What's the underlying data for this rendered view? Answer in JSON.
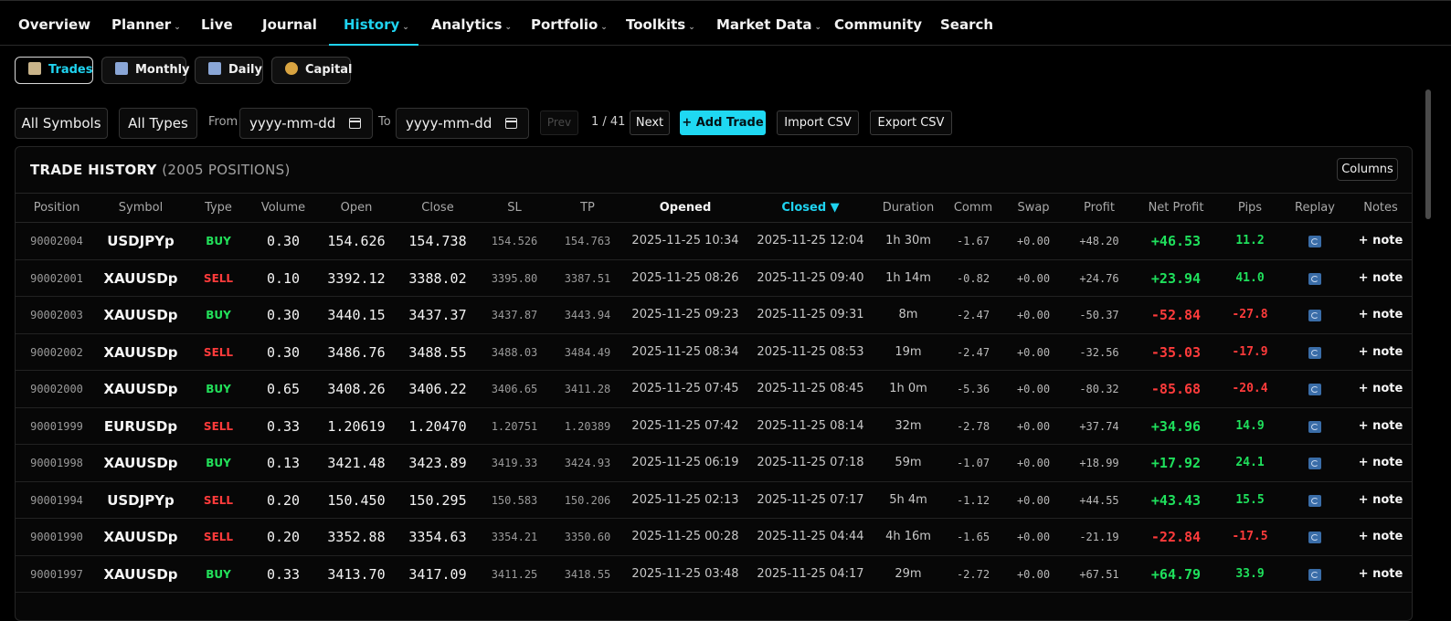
{
  "nav": {
    "items": [
      {
        "label": "Overview",
        "caret": ""
      },
      {
        "label": "Planner",
        "caret": "⌄"
      },
      {
        "label": "Live",
        "caret": ""
      },
      {
        "label": "Journal",
        "caret": ""
      },
      {
        "label": "History",
        "caret": "⌄"
      },
      {
        "label": "Analytics",
        "caret": "⌄"
      },
      {
        "label": "Portfolio",
        "caret": "⌄"
      },
      {
        "label": "Toolkits",
        "caret": "⌄"
      },
      {
        "label": "Market Data",
        "caret": "⌄"
      },
      {
        "label": "Community",
        "caret": ""
      },
      {
        "label": "Search",
        "caret": ""
      }
    ],
    "active": "History"
  },
  "subtabs": [
    {
      "label": "Trades",
      "icon": "ledger-icon",
      "color": "#c9b48a"
    },
    {
      "label": "Monthly",
      "icon": "calendar-icon",
      "color": "#8aa6d6"
    },
    {
      "label": "Daily",
      "icon": "calendar-icon",
      "color": "#8aa6d6"
    },
    {
      "label": "Capital",
      "icon": "money-bag-icon",
      "color": "#d9a441"
    }
  ],
  "filters": {
    "symbols": "All Symbols",
    "types": "All Types",
    "from_label": "From",
    "from_placeholder": "yyyy-mm-dd",
    "to_label": "To",
    "to_placeholder": "yyyy-mm-dd",
    "prev": "Prev",
    "page": "1 / 41",
    "next": "Next",
    "add": "+ Add Trade",
    "import": "Import CSV",
    "export": "Export CSV"
  },
  "table": {
    "title": "TRADE HISTORY",
    "subtitle": "(2005 POSITIONS)",
    "columns_button": "Columns",
    "headers": [
      "Position",
      "Symbol",
      "Type",
      "Volume",
      "Open",
      "Close",
      "SL",
      "TP",
      "Opened",
      "Closed ▼",
      "Duration",
      "Comm",
      "Swap",
      "Profit",
      "Net Profit",
      "Pips",
      "Replay",
      "Notes"
    ],
    "rows": [
      {
        "pos": "90002004",
        "sym": "USDJPYp",
        "type": "BUY",
        "vol": "0.30",
        "open": "154.626",
        "close": "154.738",
        "sl": "154.526",
        "tp": "154.763",
        "opened": "2025-11-25 10:34",
        "closed": "2025-11-25 12:04",
        "dur": "1h 30m",
        "comm": "-1.67",
        "swap": "+0.00",
        "profit": "+48.20",
        "net": "+46.53",
        "pips": "11.2",
        "note": "+ note"
      },
      {
        "pos": "90002001",
        "sym": "XAUUSDp",
        "type": "SELL",
        "vol": "0.10",
        "open": "3392.12",
        "close": "3388.02",
        "sl": "3395.80",
        "tp": "3387.51",
        "opened": "2025-11-25 08:26",
        "closed": "2025-11-25 09:40",
        "dur": "1h 14m",
        "comm": "-0.82",
        "swap": "+0.00",
        "profit": "+24.76",
        "net": "+23.94",
        "pips": "41.0",
        "note": "+ note"
      },
      {
        "pos": "90002003",
        "sym": "XAUUSDp",
        "type": "BUY",
        "vol": "0.30",
        "open": "3440.15",
        "close": "3437.37",
        "sl": "3437.87",
        "tp": "3443.94",
        "opened": "2025-11-25 09:23",
        "closed": "2025-11-25 09:31",
        "dur": "8m",
        "comm": "-2.47",
        "swap": "+0.00",
        "profit": "-50.37",
        "net": "-52.84",
        "pips": "-27.8",
        "note": "+ note"
      },
      {
        "pos": "90002002",
        "sym": "XAUUSDp",
        "type": "SELL",
        "vol": "0.30",
        "open": "3486.76",
        "close": "3488.55",
        "sl": "3488.03",
        "tp": "3484.49",
        "opened": "2025-11-25 08:34",
        "closed": "2025-11-25 08:53",
        "dur": "19m",
        "comm": "-2.47",
        "swap": "+0.00",
        "profit": "-32.56",
        "net": "-35.03",
        "pips": "-17.9",
        "note": "+ note"
      },
      {
        "pos": "90002000",
        "sym": "XAUUSDp",
        "type": "BUY",
        "vol": "0.65",
        "open": "3408.26",
        "close": "3406.22",
        "sl": "3406.65",
        "tp": "3411.28",
        "opened": "2025-11-25 07:45",
        "closed": "2025-11-25 08:45",
        "dur": "1h 0m",
        "comm": "-5.36",
        "swap": "+0.00",
        "profit": "-80.32",
        "net": "-85.68",
        "pips": "-20.4",
        "note": "+ note"
      },
      {
        "pos": "90001999",
        "sym": "EURUSDp",
        "type": "SELL",
        "vol": "0.33",
        "open": "1.20619",
        "close": "1.20470",
        "sl": "1.20751",
        "tp": "1.20389",
        "opened": "2025-11-25 07:42",
        "closed": "2025-11-25 08:14",
        "dur": "32m",
        "comm": "-2.78",
        "swap": "+0.00",
        "profit": "+37.74",
        "net": "+34.96",
        "pips": "14.9",
        "note": "+ note"
      },
      {
        "pos": "90001998",
        "sym": "XAUUSDp",
        "type": "BUY",
        "vol": "0.13",
        "open": "3421.48",
        "close": "3423.89",
        "sl": "3419.33",
        "tp": "3424.93",
        "opened": "2025-11-25 06:19",
        "closed": "2025-11-25 07:18",
        "dur": "59m",
        "comm": "-1.07",
        "swap": "+0.00",
        "profit": "+18.99",
        "net": "+17.92",
        "pips": "24.1",
        "note": "+ note"
      },
      {
        "pos": "90001994",
        "sym": "USDJPYp",
        "type": "SELL",
        "vol": "0.20",
        "open": "150.450",
        "close": "150.295",
        "sl": "150.583",
        "tp": "150.206",
        "opened": "2025-11-25 02:13",
        "closed": "2025-11-25 07:17",
        "dur": "5h 4m",
        "comm": "-1.12",
        "swap": "+0.00",
        "profit": "+44.55",
        "net": "+43.43",
        "pips": "15.5",
        "note": "+ note"
      },
      {
        "pos": "90001990",
        "sym": "XAUUSDp",
        "type": "SELL",
        "vol": "0.20",
        "open": "3352.88",
        "close": "3354.63",
        "sl": "3354.21",
        "tp": "3350.60",
        "opened": "2025-11-25 00:28",
        "closed": "2025-11-25 04:44",
        "dur": "4h 16m",
        "comm": "-1.65",
        "swap": "+0.00",
        "profit": "-21.19",
        "net": "-22.84",
        "pips": "-17.5",
        "note": "+ note"
      },
      {
        "pos": "90001997",
        "sym": "XAUUSDp",
        "type": "BUY",
        "vol": "0.33",
        "open": "3413.70",
        "close": "3417.09",
        "sl": "3411.25",
        "tp": "3418.55",
        "opened": "2025-11-25 03:48",
        "closed": "2025-11-25 04:17",
        "dur": "29m",
        "comm": "-2.72",
        "swap": "+0.00",
        "profit": "+67.51",
        "net": "+64.79",
        "pips": "33.9",
        "note": "+ note"
      }
    ]
  },
  "colors": {
    "accent": "#1fd3f0",
    "positive": "#1fe05c",
    "negative": "#ff3b3b"
  }
}
